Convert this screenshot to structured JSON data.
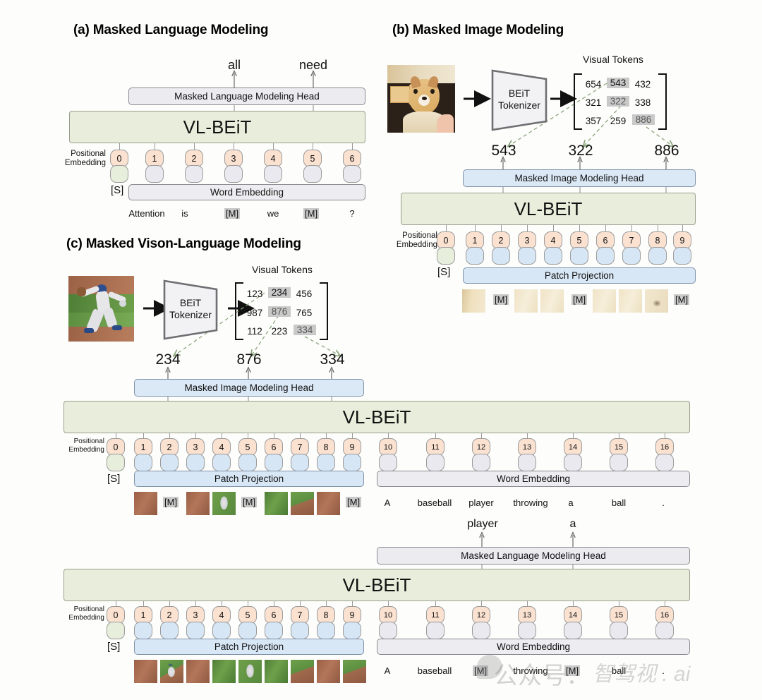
{
  "panels": {
    "a": {
      "title": "(a) Masked Language Modeling",
      "outputs": [
        "all",
        "need"
      ],
      "head_label": "Masked Language Modeling Head",
      "backbone_label": "VL-BEiT",
      "embedding_label": "Word Embedding",
      "positional_label_line1": "Positional",
      "positional_label_line2": "Embedding",
      "start_token": "[S]",
      "positions": [
        "0",
        "1",
        "2",
        "3",
        "4",
        "5",
        "6"
      ],
      "tokens": [
        "Attention",
        "is",
        "[M]",
        "we",
        "[M]",
        "?"
      ],
      "masked_tokens": [
        "[M]"
      ]
    },
    "b": {
      "title": "(b) Masked Image Modeling",
      "tokenizer_line1": "BEiT",
      "tokenizer_line2": "Tokenizer",
      "visual_tokens_title": "Visual Tokens",
      "matrix": [
        [
          "654",
          "543",
          "432"
        ],
        [
          "321",
          "322",
          "338"
        ],
        [
          "357",
          "259",
          "886"
        ]
      ],
      "highlighted": [
        "543",
        "322",
        "886"
      ],
      "predictions": [
        "543",
        "322",
        "886"
      ],
      "head_label": "Masked Image Modeling Head",
      "backbone_label": "VL-BEiT",
      "embedding_label": "Patch Projection",
      "positional_label_line1": "Positional",
      "positional_label_line2": "Embedding",
      "start_token": "[S]",
      "positions": [
        "0",
        "1",
        "2",
        "3",
        "4",
        "5",
        "6",
        "7",
        "8",
        "9"
      ],
      "patch_slots": [
        "image",
        "mask",
        "image",
        "image",
        "mask",
        "image",
        "image",
        "image",
        "mask"
      ],
      "mask_label": "[M]"
    },
    "c": {
      "title": "(c) Masked Vison-Language Modeling",
      "tokenizer_line1": "BEiT",
      "tokenizer_line2": "Tokenizer",
      "visual_tokens_title": "Visual Tokens",
      "matrix": [
        [
          "123",
          "234",
          "456"
        ],
        [
          "987",
          "876",
          "765"
        ],
        [
          "112",
          "223",
          "334"
        ]
      ],
      "highlighted": [
        "234",
        "876",
        "334"
      ],
      "predictions": [
        "234",
        "876",
        "334"
      ],
      "mim_head_label": "Masked Image Modeling Head",
      "mlm_head_label": "Masked Language Modeling Head",
      "backbone_label": "VL-BEiT",
      "patch_embedding_label": "Patch Projection",
      "word_embedding_label": "Word Embedding",
      "positional_label_line1": "Positional",
      "positional_label_line2": "Embedding",
      "start_token": "[S]",
      "positions": [
        "0",
        "1",
        "2",
        "3",
        "4",
        "5",
        "6",
        "7",
        "8",
        "9",
        "10",
        "11",
        "12",
        "13",
        "14",
        "15",
        "16"
      ],
      "mask_label": "[M]",
      "top_row": {
        "patch_slots": [
          "image",
          "mask",
          "image",
          "image",
          "mask",
          "image",
          "image",
          "image",
          "mask"
        ],
        "words": [
          "A",
          "baseball",
          "player",
          "throwing",
          "a",
          "ball",
          "."
        ]
      },
      "bottom_row": {
        "outputs": [
          "player",
          "a"
        ],
        "patch_slots": [
          "image",
          "image",
          "image",
          "image",
          "image",
          "image",
          "image",
          "image",
          "image"
        ],
        "words": [
          "A",
          "baseball",
          "[M]",
          "throwing",
          "[M]",
          "ball",
          "."
        ],
        "masked_words": [
          "[M]"
        ]
      }
    }
  },
  "watermark": {
    "text_cn": "公众号：",
    "text_brand": "智驾视 . ai"
  },
  "colors": {
    "backbone_fill": "#e9eedc",
    "head_blue_fill": "#dbe8f5",
    "head_gray_fill": "#ebebf0",
    "positional_fill": "#fae1d0",
    "token_blue_fill": "#d7e6f5",
    "token_gray_fill": "#e9e9ef",
    "mask_highlight": "#c9c9c9",
    "dashed_arrow": "#8ba47c",
    "border": "#8e8e8e"
  }
}
